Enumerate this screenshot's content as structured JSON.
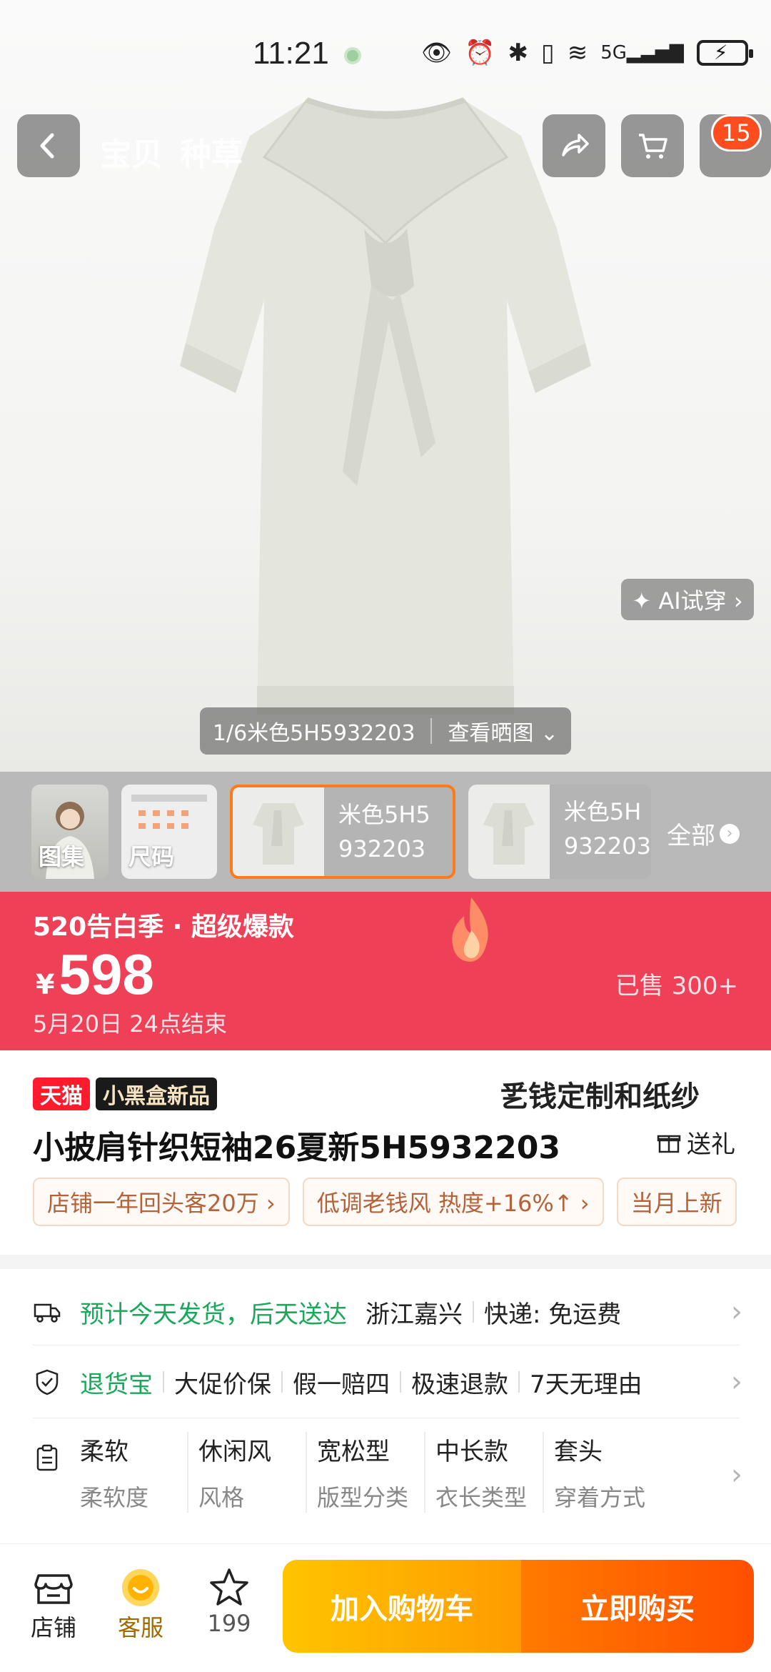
{
  "status_bar": {
    "time": "11:21",
    "icons": [
      "eye-icon",
      "alarm-icon",
      "bluetooth-icon",
      "vibrate-icon",
      "wifi-icon",
      "5g-signal-icon",
      "battery-charging-icon"
    ]
  },
  "nav": {
    "tabs": [
      "宝贝",
      "种草"
    ],
    "cart_badge": "15"
  },
  "gallery": {
    "ai_tryon_label": "✦ AI试穿 ›",
    "counter": "1/6米色5H5932203",
    "view_reviews_label": "查看晒图 ⌄"
  },
  "thumbs": {
    "gallery_label": "图集",
    "size_label": "尺码",
    "variants": [
      {
        "line1": "米色5H5",
        "line2": "932203",
        "selected": true
      },
      {
        "line1": "米色5H",
        "line2": "932203",
        "selected": false
      }
    ],
    "all_label": "全部"
  },
  "promo": {
    "title": "520告白季 · 超级爆款",
    "currency": "¥",
    "price": "598",
    "sold": "已售 300+",
    "end_time": "5月20日 24点结束"
  },
  "product": {
    "tag_tmall": "天猫",
    "tag_blackbox": "小黑盒新品",
    "brand_slogan": "乯钱定制和纸纱",
    "title": "小披肩针织短袖26夏新5H5932203",
    "gift_label": "送礼",
    "chips": [
      "店铺一年回头客20万 ›",
      "低调老钱风 热度+16%↑ ›",
      "当月上新"
    ]
  },
  "shipping": {
    "highlight": "预计今天发货，后天送达",
    "origin": "浙江嘉兴",
    "delivery": "快递: 免运费"
  },
  "guarantee": {
    "highlight": "退货宝",
    "items": [
      "大促价保",
      "假一赔四",
      "极速退款",
      "7天无理由"
    ]
  },
  "attributes": [
    {
      "value": "柔软",
      "key": "柔软度"
    },
    {
      "value": "休闲风",
      "key": "风格"
    },
    {
      "value": "宽松型",
      "key": "版型分类"
    },
    {
      "value": "中长款",
      "key": "衣长类型"
    },
    {
      "value": "套头",
      "key": "穿着方式"
    }
  ],
  "bottom_bar": {
    "store_label": "店铺",
    "service_label": "客服",
    "favorites_count": "199",
    "add_cart_label": "加入购物车",
    "buy_now_label": "立即购买"
  },
  "colors": {
    "promo_red": "#ee4057",
    "tmall_red": "#ff1a2e",
    "accent_orange": "#ff7a1a",
    "green": "#1aa85a"
  }
}
